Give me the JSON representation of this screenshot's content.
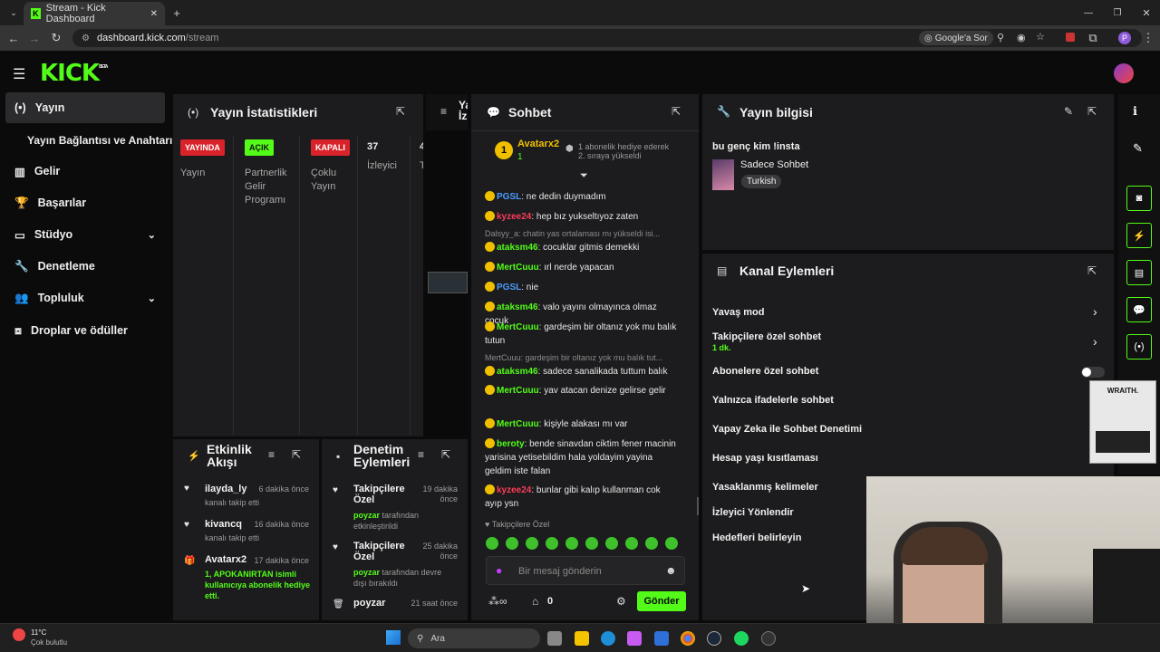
{
  "browser": {
    "tab_title": "Stream - Kick Dashboard",
    "url_host": "dashboard.kick.com",
    "url_path": "/stream",
    "google_btn": "Google'a Sor",
    "profile_letter": "P"
  },
  "header": {
    "logo": "KICK",
    "logo_sup": "BETA"
  },
  "sidebar": {
    "items": [
      {
        "label": "Yayın",
        "icon": "broadcast-icon"
      },
      {
        "label": "Yayın Bağlantısı ve Anahtarı",
        "icon": ""
      },
      {
        "label": "Gelir",
        "icon": "chart-icon"
      },
      {
        "label": "Başarılar",
        "icon": "trophy-icon"
      },
      {
        "label": "Stüdyo",
        "icon": "studio-icon"
      },
      {
        "label": "Denetleme",
        "icon": "wrench-icon"
      },
      {
        "label": "Topluluk",
        "icon": "community-icon"
      },
      {
        "label": "Droplar ve ödüller",
        "icon": "drops-icon"
      }
    ]
  },
  "stats": {
    "title": "Yayın İstatistikleri",
    "cols": [
      {
        "badge": "YAYINDA",
        "label": "Yayın",
        "color": "#d8232a"
      },
      {
        "badge": "AÇIK",
        "label": "Partnerlik Gelir Programı",
        "color": "#53fc18"
      },
      {
        "badge": "KAPALI",
        "label": "Çoklu Yayın",
        "color": "#d8232a"
      },
      {
        "badge": "37",
        "label": "İzleyici",
        "color": ""
      },
      {
        "badge": "4",
        "label": "T",
        "color": ""
      }
    ]
  },
  "preview": {
    "title": "Ya İz"
  },
  "chat": {
    "title": "Sohbet",
    "pinned_user": "Avatarx2",
    "pinned_count": "1",
    "pinned_note": "1 abonelik hediye ederek 2. sıraya yükseldi",
    "messages": [
      {
        "user": "PGSL",
        "color": "#4a9dff",
        "text": ": ne dedin duymadım"
      },
      {
        "user": "kyzee24",
        "color": "#ff3b5b",
        "text": ": hep bız yukseltıyoz zaten"
      },
      {
        "reply": "Dalsyy_a: chatin yas ortalaması mı yükseldi isi..."
      },
      {
        "user": "ataksm46",
        "color": "#53fc18",
        "text": ": cocuklar gitmis demekki"
      },
      {
        "user": "MertCuuu",
        "color": "#53fc18",
        "text": ": ırl nerde yapacan"
      },
      {
        "user": "PGSL",
        "color": "#4a9dff",
        "text": ": nie"
      },
      {
        "user": "ataksm46",
        "color": "#53fc18",
        "text": ": valo yayını olmayınca olmaz cocuk"
      },
      {
        "user": "MertCuuu",
        "color": "#53fc18",
        "text": ": gardeşim bir oltanız yok mu balık tutun"
      },
      {
        "reply": "MertCuuu: gardeşim bir oltanız yok mu balık tut..."
      },
      {
        "user": "ataksm46",
        "color": "#53fc18",
        "text": ": sadece sanalikada tuttum balık"
      },
      {
        "user": "MertCuuu",
        "color": "#53fc18",
        "text": ": yav atacan denize gelirse gelir"
      },
      {
        "user": "MertCuuu",
        "color": "#53fc18",
        "text": ": kişiyle alakası mı var"
      },
      {
        "user": "beroty",
        "color": "#53fc18",
        "text": ": bende sinavdan ciktim fener macinin yarisina yetisebildim hala yoldayim yayina geldim iste falan"
      },
      {
        "user": "kyzee24",
        "color": "#ff3b5b",
        "text": ": bunlar gibi kalıp kullanman cok ayıp ysn"
      }
    ],
    "followers_label": "Takipçilere Özel",
    "input_placeholder": "Bir mesaj gönderin",
    "points": "0",
    "send": "Gönder"
  },
  "info": {
    "title": "Yayın bilgisi",
    "stream_title": "bu genç kim !insta",
    "category": "Sadece Sohbet",
    "tag": "Turkish"
  },
  "actions": {
    "title": "Kanal Eylemleri",
    "items": [
      {
        "label": "Yavaş mod",
        "sub": ""
      },
      {
        "label": "Takipçilere özel sohbet",
        "sub": "1 dk."
      },
      {
        "label": "Abonelere özel sohbet",
        "sub": ""
      },
      {
        "label": "Yalnızca ifadelerle sohbet",
        "sub": ""
      },
      {
        "label": "Yapay Zeka ile Sohbet Denetimi",
        "sub": ""
      },
      {
        "label": "Hesap yaşı kısıtlaması",
        "sub": ""
      },
      {
        "label": "Yasaklanmış kelimeler",
        "sub": ""
      },
      {
        "label": "İzleyici Yönlendir",
        "sub": ""
      },
      {
        "label": "Hedefleri belirleyin",
        "sub": ""
      }
    ]
  },
  "activity": {
    "title": "Etkinlik Akışı",
    "items": [
      {
        "user": "ilayda_ly",
        "when": "6 dakika önce",
        "desc": "kanalı takip etti"
      },
      {
        "user": "kivancq",
        "when": "16 dakika önce",
        "desc": "kanalı takip etti"
      },
      {
        "user": "Avatarx2",
        "when": "17 dakika önce",
        "desc": "1, APOKANIRTAN isimli kullanıcıya abonelik hediye etti."
      }
    ]
  },
  "modlog": {
    "title": "Denetim Eylemleri",
    "items": [
      {
        "title": "Takipçilere Özel",
        "when": "19 dakika önce",
        "by": "poyzar",
        "desc": "tarafından etkinleştirildi"
      },
      {
        "title": "Takipçilere Özel",
        "when": "25 dakika önce",
        "by": "poyzar",
        "desc": "tarafından devre dışı bırakıldı"
      },
      {
        "title": "poyzar",
        "when": "21 saat önce",
        "by": "",
        "desc": ""
      }
    ]
  },
  "ad": {
    "brand": "WRAITH."
  },
  "taskbar": {
    "temp": "11°C",
    "weather": "Çok bulutlu",
    "search": "Ara"
  }
}
